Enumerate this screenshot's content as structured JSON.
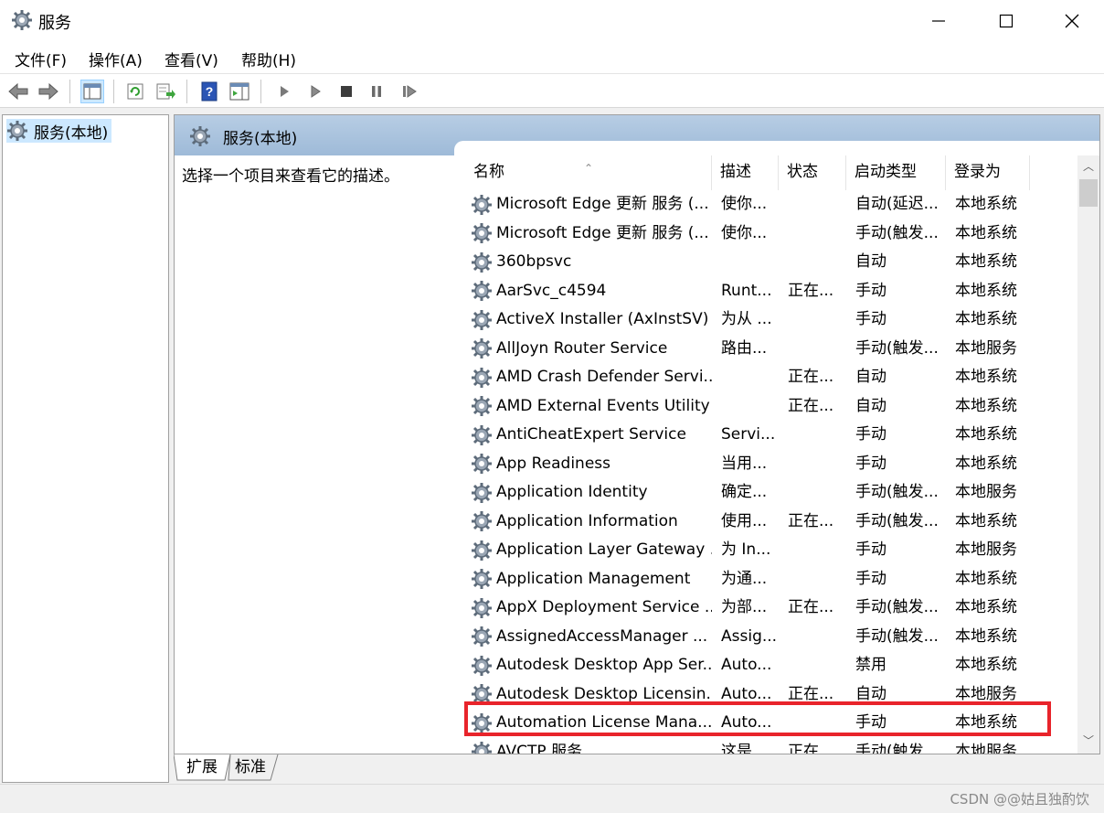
{
  "window": {
    "title": "服务"
  },
  "menu": [
    {
      "label": "文件(F)"
    },
    {
      "label": "操作(A)"
    },
    {
      "label": "查看(V)"
    },
    {
      "label": "帮助(H)"
    }
  ],
  "tree": {
    "selected_item": "服务(本地)"
  },
  "pane": {
    "title": "服务(本地)",
    "description_hint": "选择一个项目来查看它的描述。"
  },
  "table": {
    "columns": [
      "名称",
      "描述",
      "状态",
      "启动类型",
      "登录为"
    ],
    "rows": [
      {
        "name": "Microsoft Edge 更新 服务 (...",
        "desc": "使你...",
        "status": "",
        "startup": "自动(延迟...",
        "logon": "本地系统"
      },
      {
        "name": "Microsoft Edge 更新 服务 (...",
        "desc": "使你...",
        "status": "",
        "startup": "手动(触发...",
        "logon": "本地系统"
      },
      {
        "name": "360bpsvc",
        "desc": "",
        "status": "",
        "startup": "自动",
        "logon": "本地系统"
      },
      {
        "name": "AarSvc_c4594",
        "desc": "Runt...",
        "status": "正在...",
        "startup": "手动",
        "logon": "本地系统"
      },
      {
        "name": "ActiveX Installer (AxInstSV)",
        "desc": "为从 ...",
        "status": "",
        "startup": "手动",
        "logon": "本地系统"
      },
      {
        "name": "AllJoyn Router Service",
        "desc": "路由...",
        "status": "",
        "startup": "手动(触发...",
        "logon": "本地服务"
      },
      {
        "name": "AMD Crash Defender Servi...",
        "desc": "",
        "status": "正在...",
        "startup": "自动",
        "logon": "本地系统"
      },
      {
        "name": "AMD External Events Utility",
        "desc": "",
        "status": "正在...",
        "startup": "自动",
        "logon": "本地系统"
      },
      {
        "name": "AntiCheatExpert Service",
        "desc": "Servi...",
        "status": "",
        "startup": "手动",
        "logon": "本地系统"
      },
      {
        "name": "App Readiness",
        "desc": "当用...",
        "status": "",
        "startup": "手动",
        "logon": "本地系统"
      },
      {
        "name": "Application Identity",
        "desc": "确定...",
        "status": "",
        "startup": "手动(触发...",
        "logon": "本地服务"
      },
      {
        "name": "Application Information",
        "desc": "使用...",
        "status": "正在...",
        "startup": "手动(触发...",
        "logon": "本地系统"
      },
      {
        "name": "Application Layer Gateway ...",
        "desc": "为 In...",
        "status": "",
        "startup": "手动",
        "logon": "本地服务"
      },
      {
        "name": "Application Management",
        "desc": "为通...",
        "status": "",
        "startup": "手动",
        "logon": "本地系统"
      },
      {
        "name": "AppX Deployment Service ...",
        "desc": "为部...",
        "status": "正在...",
        "startup": "手动(触发...",
        "logon": "本地系统"
      },
      {
        "name": "AssignedAccessManager ...",
        "desc": "Assig...",
        "status": "",
        "startup": "手动(触发...",
        "logon": "本地系统"
      },
      {
        "name": "Autodesk Desktop App Ser...",
        "desc": "Auto...",
        "status": "",
        "startup": "禁用",
        "logon": "本地系统"
      },
      {
        "name": "Autodesk Desktop Licensin...",
        "desc": "Auto...",
        "status": "正在...",
        "startup": "自动",
        "logon": "本地服务"
      },
      {
        "name": "Automation License Mana...",
        "desc": "Auto...",
        "status": "",
        "startup": "手动",
        "logon": "本地系统"
      },
      {
        "name": "AVCTP 服务",
        "desc": "这是...",
        "status": "正在...",
        "startup": "手动(触发...",
        "logon": "本地服务"
      }
    ]
  },
  "tabs": [
    {
      "label": "扩展"
    },
    {
      "label": "标准"
    }
  ],
  "watermark": "CSDN @@姑且独酌饮",
  "colors": {
    "highlight": "#e8242b",
    "header_blue": "#a9c3de",
    "selection": "#cce8ff"
  }
}
